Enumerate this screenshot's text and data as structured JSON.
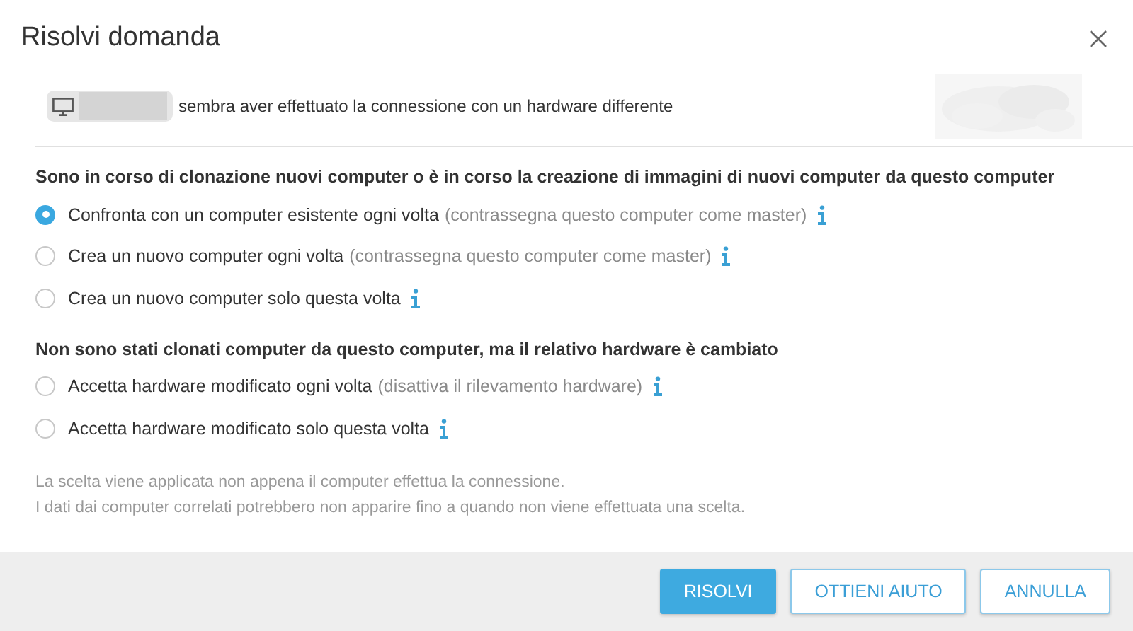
{
  "dialog": {
    "title": "Risolvi domanda"
  },
  "notice": {
    "text": "sembra aver effettuato la connessione con un hardware differente"
  },
  "sections": [
    {
      "heading": "Sono in corso di clonazione nuovi computer o è in corso la creazione di immagini di nuovi computer da questo computer",
      "options": [
        {
          "label": "Confronta con un computer esistente ogni volta",
          "hint": "(contrassegna questo computer come master)",
          "selected": true
        },
        {
          "label": "Crea un nuovo computer ogni volta",
          "hint": "(contrassegna questo computer come master)",
          "selected": false
        },
        {
          "label": "Crea un nuovo computer solo questa volta",
          "selected": false
        }
      ]
    },
    {
      "heading": "Non sono stati clonati computer da questo computer, ma il relativo hardware è cambiato",
      "options": [
        {
          "label": "Accetta hardware modificato ogni volta",
          "hint": "(disattiva il rilevamento hardware)",
          "selected": false
        },
        {
          "label": "Accetta hardware modificato solo questa volta",
          "selected": false
        }
      ]
    }
  ],
  "notes": [
    "La scelta viene applicata non appena il computer effettua la connessione.",
    "I dati dai computer correlati potrebbero non apparire fino a quando non viene effettuata una scelta."
  ],
  "buttons": [
    {
      "label": "RISOLVI",
      "kind": "primary"
    },
    {
      "label": "OTTIENI AIUTO",
      "kind": "secondary"
    },
    {
      "label": "ANNULLA",
      "kind": "secondary"
    }
  ]
}
